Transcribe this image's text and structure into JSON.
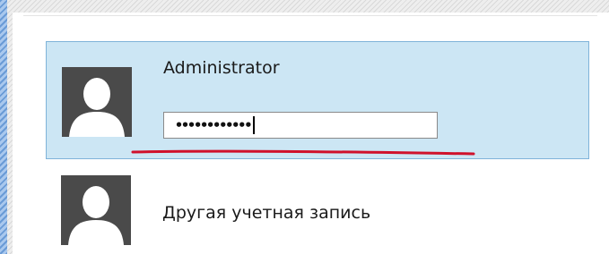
{
  "accounts": [
    {
      "name": "Administrator",
      "avatar_icon": "user-silhouette-icon",
      "selected": true,
      "password_masked": "••••••••••••"
    },
    {
      "name": "Другая учетная запись",
      "avatar_icon": "user-silhouette-icon",
      "selected": false
    }
  ],
  "colors": {
    "selected_bg": "#cce6f4",
    "selected_border": "#7fb3d9",
    "avatar_bg": "#4a4a4a",
    "annotation_red": "#d0112b"
  }
}
